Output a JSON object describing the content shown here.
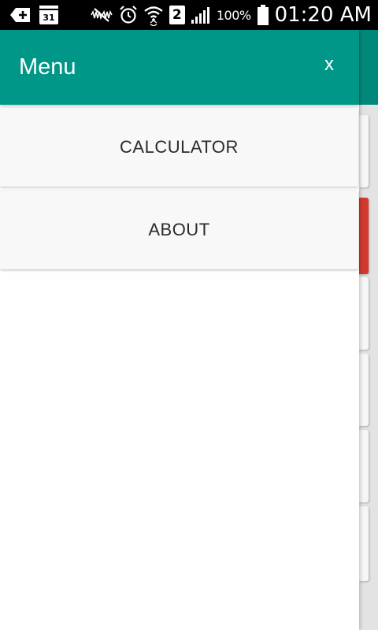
{
  "status_bar": {
    "calendar_day": "31",
    "sim_slot": "2",
    "battery_percent": "100%",
    "time": "01:20 AM",
    "icons": [
      "add-box-icon",
      "calendar-icon",
      "mute-icon",
      "alarm-icon",
      "wifi-icon",
      "sim-icon",
      "signal-icon",
      "battery-icon"
    ]
  },
  "drawer": {
    "title": "Menu",
    "close_label": "x",
    "items": [
      {
        "label": "CALCULATOR"
      },
      {
        "label": "ABOUT"
      }
    ]
  },
  "colors": {
    "primary": "#009688",
    "status_bar": "#000000",
    "menu_item_bg": "#f8f8f8",
    "accent_red": "#d33a2e"
  }
}
